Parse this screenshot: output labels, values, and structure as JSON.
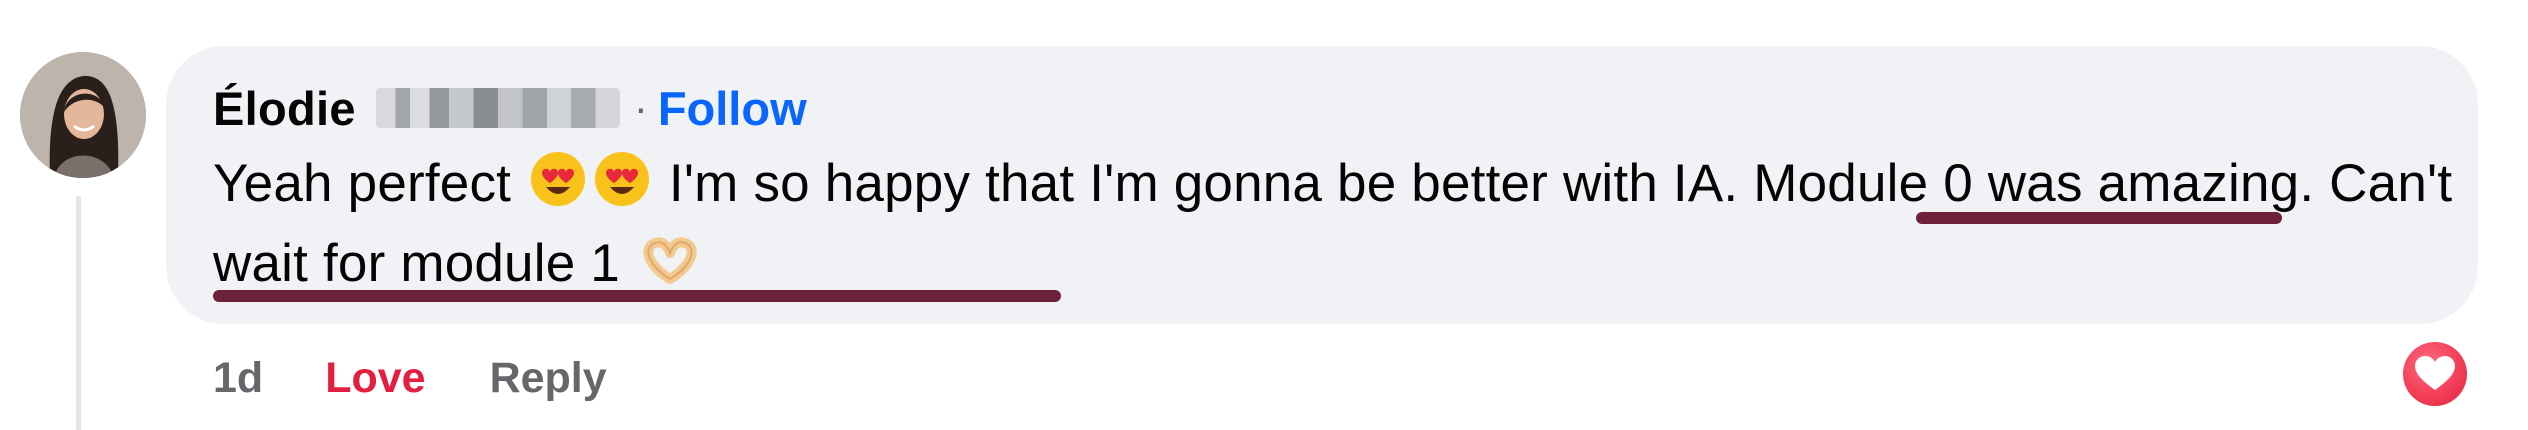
{
  "comment": {
    "author": "Élodie",
    "separator": "·",
    "follow_label": "Follow",
    "text_parts": [
      "Yeah perfect ",
      " I'm so happy that I'm gonna be better with IA. Module 0 was amazing. Can't wait for module 1 "
    ],
    "emojis": [
      "heart-eyes-emoji",
      "heart-eyes-emoji",
      "heart-hands-emoji"
    ],
    "meta": {
      "time": "1d",
      "love_label": "Love",
      "reply_label": "Reply"
    },
    "reaction": "love-reaction-icon"
  },
  "colors": {
    "bubble": "#f0f2f5",
    "follow": "#0866ff",
    "love": "#e41e3f",
    "underline": "#6e2138",
    "muted": "#65676b"
  }
}
